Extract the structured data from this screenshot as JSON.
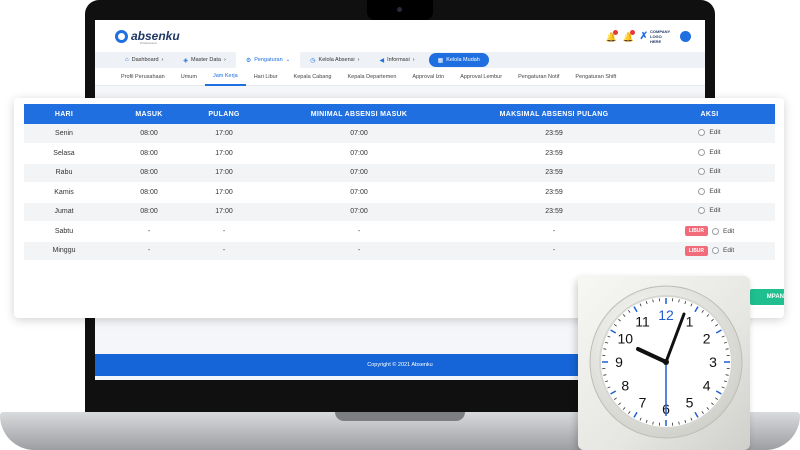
{
  "brand": {
    "name": "absenku",
    "tagline": "Professional",
    "company_label": "COMPANY LOGO HERE"
  },
  "main_nav": [
    {
      "label": "Dashboard",
      "icon": "home-icon",
      "chevron": "›"
    },
    {
      "label": "Master Data",
      "icon": "shield-icon",
      "chevron": "›"
    },
    {
      "label": "Pengaturan",
      "icon": "gear-icon",
      "chevron": "⌄"
    },
    {
      "label": "Kelola Absensi",
      "icon": "clock-icon",
      "chevron": "›"
    },
    {
      "label": "Informasi",
      "icon": "megaphone-icon",
      "chevron": "›"
    },
    {
      "label": "Kelola Mudah",
      "icon": "grid-icon",
      "chevron": ""
    }
  ],
  "sub_nav": [
    "Profil Perusahaan",
    "Umum",
    "Jam Kerja",
    "Hari Libur",
    "Kepala Cabang",
    "Kepala Departemen",
    "Approval Izin",
    "Approval Lembur",
    "Pengaturan Notif",
    "Pengaturan Shift"
  ],
  "sub_nav_active": "Jam Kerja",
  "table": {
    "headers": {
      "day": "HARI",
      "in": "MASUK",
      "out": "PULANG",
      "min": "MINIMAL ABSENSI MASUK",
      "max": "MAKSIMAL ABSENSI PULANG",
      "action": "AKSI"
    },
    "rows": [
      {
        "day": "Senin",
        "in": "08:00",
        "out": "17:00",
        "min": "07:00",
        "max": "23:59",
        "libur": "",
        "edit": "Edit"
      },
      {
        "day": "Selasa",
        "in": "08:00",
        "out": "17:00",
        "min": "07:00",
        "max": "23:59",
        "libur": "",
        "edit": "Edit"
      },
      {
        "day": "Rabu",
        "in": "08:00",
        "out": "17:00",
        "min": "07:00",
        "max": "23:59",
        "libur": "",
        "edit": "Edit"
      },
      {
        "day": "Kamis",
        "in": "08:00",
        "out": "17:00",
        "min": "07:00",
        "max": "23:59",
        "libur": "",
        "edit": "Edit"
      },
      {
        "day": "Jumat",
        "in": "08:00",
        "out": "17:00",
        "min": "07:00",
        "max": "23:59",
        "libur": "",
        "edit": "Edit"
      },
      {
        "day": "Sabtu",
        "in": "-",
        "out": "-",
        "min": "-",
        "max": "-",
        "libur": "LIBUR",
        "edit": "Edit"
      },
      {
        "day": "Minggu",
        "in": "-",
        "out": "-",
        "min": "-",
        "max": "-",
        "libur": "LIBUR",
        "edit": "Edit"
      }
    ]
  },
  "save_label": "MPAN",
  "footer": "Copyright © 2021 Absenku",
  "clock_numbers": [
    "12",
    "1",
    "2",
    "3",
    "4",
    "5",
    "6",
    "7",
    "8",
    "9",
    "10",
    "11"
  ],
  "colors": {
    "primary": "#1f6fe0",
    "libur": "#f26b7a",
    "save": "#1fbf8f",
    "footer": "#1565d8"
  }
}
